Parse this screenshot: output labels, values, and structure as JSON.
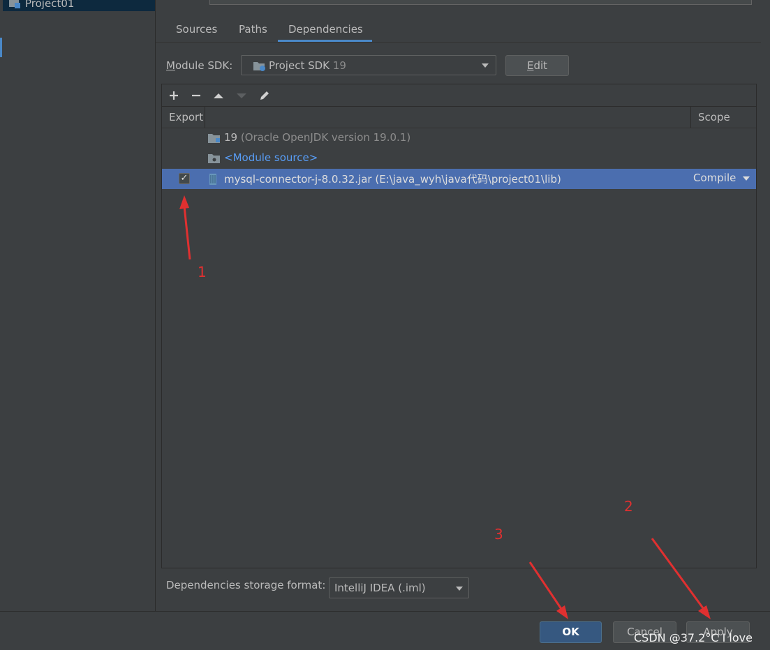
{
  "left_panel": {
    "project_name": "Project01"
  },
  "tabs": [
    {
      "label": "Sources"
    },
    {
      "label": "Paths"
    },
    {
      "label": "Dependencies",
      "active": true
    }
  ],
  "sdk": {
    "label_underlined": "M",
    "label_rest": "odule SDK:",
    "value": "Project SDK",
    "version": "19",
    "edit_underlined": "E",
    "edit_rest": "dit"
  },
  "toolbar": {
    "icons": [
      "add-icon",
      "remove-icon",
      "move-up-icon",
      "move-down-icon",
      "edit-icon"
    ]
  },
  "table": {
    "header_export": "Export",
    "header_scope": "Scope",
    "rows": [
      {
        "name": "19",
        "detail": " (Oracle OpenJDK version 19.0.1)"
      },
      {
        "name": "<Module source>"
      },
      {
        "name": "mysql-connector-j-8.0.32.jar (E:\\java_wyh\\java代码\\project01\\lib)",
        "export": true,
        "scope": "Compile",
        "selected": true
      }
    ]
  },
  "storage_format": {
    "label": "Dependencies storage format:",
    "value": "IntelliJ IDEA (.iml)"
  },
  "buttons": {
    "ok": "OK",
    "cancel": "Cancel",
    "apply": "Apply"
  },
  "watermark": "CSDN @37.2°C I love",
  "annotations": [
    "1",
    "2",
    "3"
  ],
  "colors": {
    "accent": "#4a88c7",
    "selection": "#4b6eaf",
    "annotation": "#e03030",
    "link": "#589df6"
  }
}
